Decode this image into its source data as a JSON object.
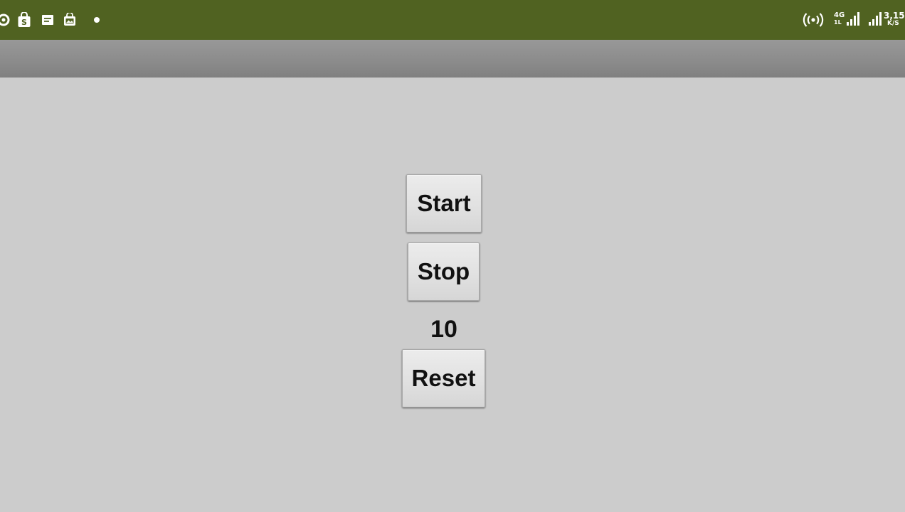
{
  "status_bar": {
    "background_color": "#506221",
    "left_icons": [
      "sync-icon",
      "shopping-bag-icon",
      "message-icon",
      "gallery-icon",
      "notification-dot-icon"
    ],
    "hotspot_icon": "hotspot-icon",
    "network_type": "4G",
    "network_sub": "1L",
    "sim1_signal_icon": "signal-icon",
    "sim2_signal_icon": "signal-icon",
    "speed_value": "3,15",
    "speed_unit": "K/S"
  },
  "app": {
    "action_bar_color": "#8c8c8c",
    "background_color": "#cccccc",
    "start_label": "Start",
    "stop_label": "Stop",
    "counter_value": "10",
    "reset_label": "Reset"
  }
}
